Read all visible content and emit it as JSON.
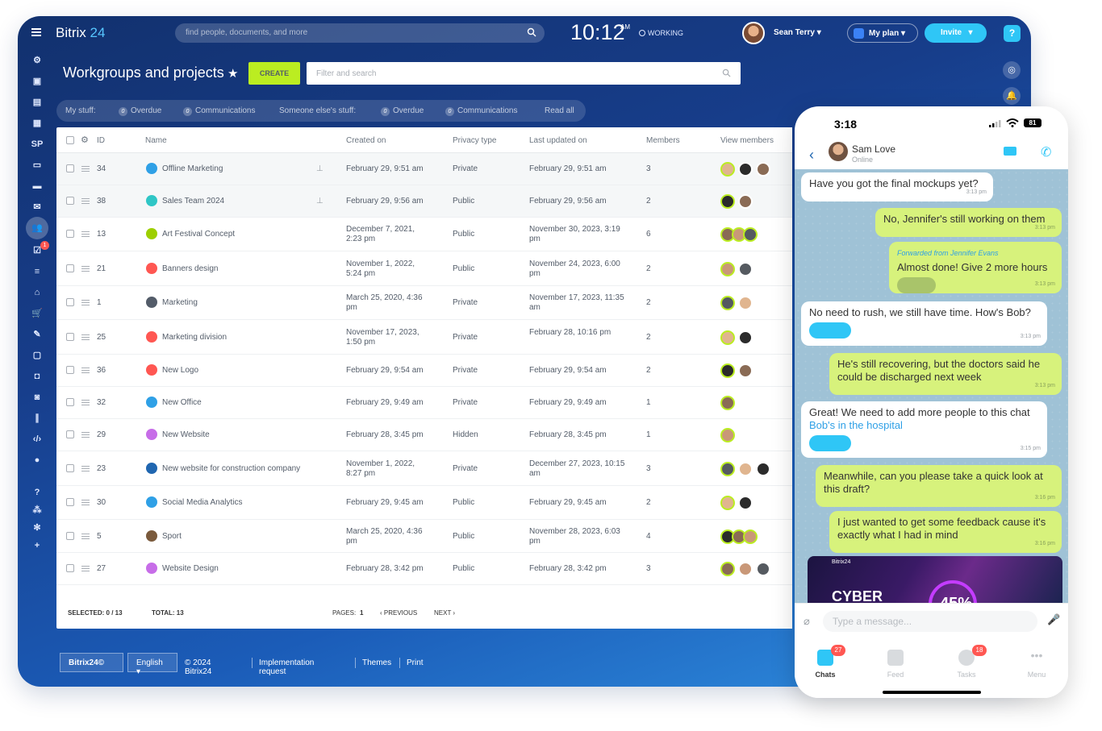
{
  "app": {
    "name": "Bitrix",
    "name_num": "24"
  },
  "topbar": {
    "search_placeholder": "find people, documents, and more",
    "clock": "10:12",
    "ampm": "AM",
    "working": "WORKING",
    "user": "Sean Terry",
    "myplan": "My plan",
    "invite": "Invite",
    "help": "?"
  },
  "sidebar": {
    "sp_label": "SP",
    "badge": "1"
  },
  "page": {
    "title": "Workgroups and projects",
    "create": "CREATE",
    "filter_placeholder": "Filter and search"
  },
  "counters": {
    "my_stuff": "My stuff:",
    "overdue1_count": "0",
    "overdue1": "Overdue",
    "comm1_count": "0",
    "comm1": "Communications",
    "someone": "Someone else's stuff:",
    "overdue2_count": "0",
    "overdue2": "Overdue",
    "comm2_count": "0",
    "comm2": "Communications",
    "read_all": "Read all"
  },
  "grid": {
    "columns": [
      "ID",
      "Name",
      "Created on",
      "Privacy type",
      "Last updated on",
      "Members",
      "View members"
    ],
    "rows": [
      {
        "id": "34",
        "name": "Offline Marketing",
        "created": "February 29, 9:51 am",
        "created2": "",
        "privacy": "Private",
        "updated": "February 29, 9:51 am",
        "updated2": "",
        "members": "3",
        "icon_color": "#2fa0e6"
      },
      {
        "id": "38",
        "name": "Sales Team 2024",
        "created": "February 29, 9:56 am",
        "created2": "",
        "privacy": "Public",
        "updated": "February 29, 9:56 am",
        "updated2": "",
        "members": "2",
        "icon_color": "#2fc6c6"
      },
      {
        "id": "13",
        "name": "Art Festival Concept",
        "created": "December 7, 2021,",
        "created2": "2:23 pm",
        "privacy": "Public",
        "updated": "November 30, 2023, 3:19",
        "updated2": "pm",
        "members": "6",
        "icon_color": "#9dcf00"
      },
      {
        "id": "21",
        "name": "Banners design",
        "created": "November 1, 2022,",
        "created2": "5:24 pm",
        "privacy": "Public",
        "updated": "November 24, 2023, 6:00",
        "updated2": "pm",
        "members": "2",
        "icon_color": "#ff5752"
      },
      {
        "id": "1",
        "name": "Marketing",
        "created": "March 25, 2020, 4:36",
        "created2": "pm",
        "privacy": "Private",
        "updated": "November 17, 2023, 11:35",
        "updated2": "am",
        "members": "2",
        "icon_color": "#535c69"
      },
      {
        "id": "25",
        "name": "Marketing division",
        "created": "November 17, 2023,",
        "created2": "1:50 pm",
        "privacy": "Private",
        "updated": "February 28, 10:16 pm",
        "updated2": "",
        "members": "2",
        "icon_color": "#ff5752"
      },
      {
        "id": "36",
        "name": "New Logo",
        "created": "February 29, 9:54 am",
        "created2": "",
        "privacy": "Private",
        "updated": "February 29, 9:54 am",
        "updated2": "",
        "members": "2",
        "icon_color": "#ff5752"
      },
      {
        "id": "32",
        "name": "New Office",
        "created": "February 29, 9:49 am",
        "created2": "",
        "privacy": "Private",
        "updated": "February 29, 9:49 am",
        "updated2": "",
        "members": "1",
        "icon_color": "#2fa0e6"
      },
      {
        "id": "29",
        "name": "New Website",
        "created": "February 28, 3:45 pm",
        "created2": "",
        "privacy": "Hidden",
        "updated": "February 28, 3:45 pm",
        "updated2": "",
        "members": "1",
        "icon_color": "#c76de8"
      },
      {
        "id": "23",
        "name": "New website for construction company",
        "created": "November 1, 2022,",
        "created2": "8:27 pm",
        "privacy": "Private",
        "updated": "December 27, 2023, 10:15",
        "updated2": "am",
        "members": "3",
        "icon_color": "#2066b0"
      },
      {
        "id": "30",
        "name": "Social Media Analytics",
        "created": "February 29, 9:45 am",
        "created2": "",
        "privacy": "Public",
        "updated": "February 29, 9:45 am",
        "updated2": "",
        "members": "2",
        "icon_color": "#2fa0e6"
      },
      {
        "id": "5",
        "name": "Sport",
        "created": "March 25, 2020, 4:36",
        "created2": "pm",
        "privacy": "Public",
        "updated": "November 28, 2023, 6:03",
        "updated2": "pm",
        "members": "4",
        "icon_color": "#7a5a3c"
      },
      {
        "id": "27",
        "name": "Website Design",
        "created": "February 28, 3:42 pm",
        "created2": "",
        "privacy": "Public",
        "updated": "February 28, 3:42 pm",
        "updated2": "",
        "members": "3",
        "icon_color": "#c76de8"
      }
    ],
    "footer": {
      "selected": "SELECTED: 0 / 13",
      "total": "TOTAL: 13",
      "pages": "PAGES:",
      "page_num": "1",
      "previous": "‹ PREVIOUS",
      "next": "NEXT ›"
    }
  },
  "footer": {
    "brand": "Bitrix24©",
    "language": "English ▾",
    "copyright": "© 2024 Bitrix24",
    "implementation": "Implementation request",
    "themes": "Themes",
    "print": "Print"
  },
  "phone": {
    "time": "3:18",
    "battery": "81",
    "contact": "Sam Love",
    "status": "Online",
    "messages": [
      {
        "text": "Have you got the final mockups yet?",
        "time": "3:13 pm"
      },
      {
        "text": "No, Jennifer's still working on them",
        "time": "3:13 pm"
      },
      {
        "forwarded": "Forwarded from Jennifer Evans",
        "text": "Almost done! Give 2 more hours",
        "time": "3:13 pm"
      },
      {
        "text": "No need to rush, we still have time. How's Bob?",
        "time": "3:13 pm"
      },
      {
        "text": "He's still recovering, but the doctors said he could be discharged next week",
        "time": "3:13 pm"
      },
      {
        "text": "Great! We need to add more people to this chat",
        "link": "Bob's in the hospital",
        "time": "3:15 pm"
      },
      {
        "text": "Meanwhile, can you please take a quick look at this draft?",
        "time": "3:16 pm"
      },
      {
        "text": "I just wanted to get some feedback cause it's exactly what I had in mind",
        "time": "3:16 pm"
      }
    ],
    "preview_tag": "Bitrix24",
    "preview_big": "CYBER",
    "preview_pct": "45%",
    "input_placeholder": "Type a message...",
    "tabs": {
      "chats": "Chats",
      "chats_badge": "27",
      "feed": "Feed",
      "tasks": "Tasks",
      "tasks_badge": "18",
      "menu": "Menu"
    }
  }
}
